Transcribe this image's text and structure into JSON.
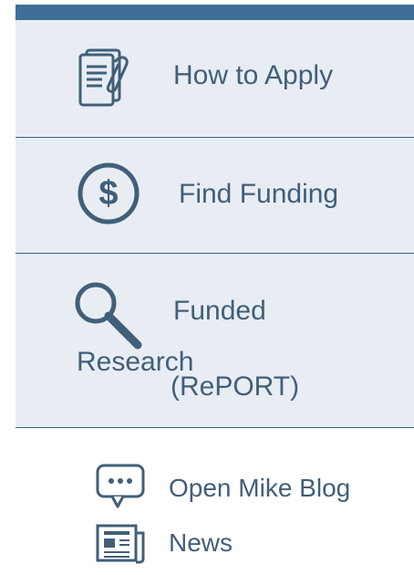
{
  "nav": {
    "primary_items": [
      {
        "label": "How to Apply",
        "icon": "application-document-icon"
      },
      {
        "label": "Find Funding",
        "icon": "dollar-circle-icon"
      },
      {
        "label_line1": "Funded",
        "label_line2": "Research",
        "label_line3": "(RePORT)",
        "icon": "magnifier-icon"
      }
    ],
    "secondary_items": [
      {
        "label": "Open Mike Blog",
        "icon": "chat-bubble-icon"
      },
      {
        "label": "News",
        "icon": "newspaper-icon"
      }
    ]
  },
  "colors": {
    "accent": "#3f6f99",
    "card_bg": "#e8edf3",
    "text": "#415f78",
    "divider": "#36627f"
  }
}
